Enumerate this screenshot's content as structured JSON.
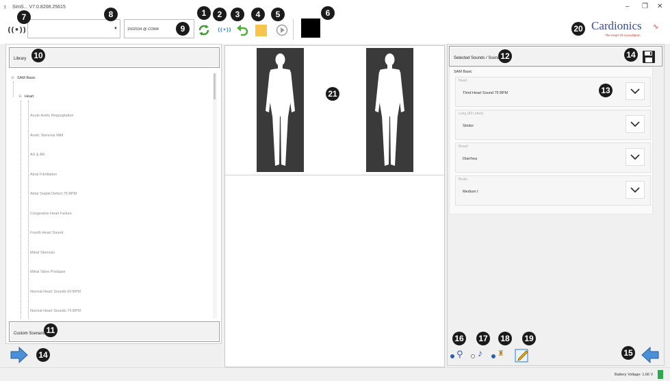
{
  "window": {
    "title": "SimS... V7.0.8208.25615",
    "minimize": "–",
    "maximize": "❐",
    "close": "✕"
  },
  "toolbar": {
    "port_value": "1502534 @ COM4",
    "selector_value": ""
  },
  "badges": [
    "1",
    "2",
    "3",
    "4",
    "5",
    "6",
    "7",
    "8",
    "9",
    "10",
    "11",
    "12",
    "13",
    "14",
    "14",
    "15",
    "16",
    "17",
    "18",
    "19",
    "20",
    "21"
  ],
  "brand": {
    "name": "Cardionics",
    "tagline": "The Heart Of Auscultation"
  },
  "library": {
    "header": "Library",
    "root": "SAM Basic",
    "group": "Heart",
    "items": [
      "Acute Aortic Regurgitation",
      "Aortic Stenosis Mild",
      "AS & AR",
      "Atrial Fibrillation",
      "Atrial Septal Defect 75 BPM",
      "Congestive Heart Failure",
      "Fourth Heart Sound",
      "Mitral Stenosis",
      "Mitral Valve Prolapse",
      "Normal Heart Sounds 60 BPM",
      "Normal Heart Sounds 75 BPM"
    ],
    "custom_header": "Custom Scenarios"
  },
  "selected": {
    "header": "Selected Sounds / Scenario",
    "group_title": "SAM Basic",
    "groups": [
      {
        "category": "Heart",
        "value": "Third Heart Sound 75 BPM"
      },
      {
        "category": "Lung (All Lobes)",
        "value": "Stridor"
      },
      {
        "category": "Bowel",
        "value": "Diarrhea"
      },
      {
        "category": "Bruits",
        "value": "Medium I"
      }
    ]
  },
  "status": {
    "battery": "Battery Voltage: 1.66 V"
  }
}
